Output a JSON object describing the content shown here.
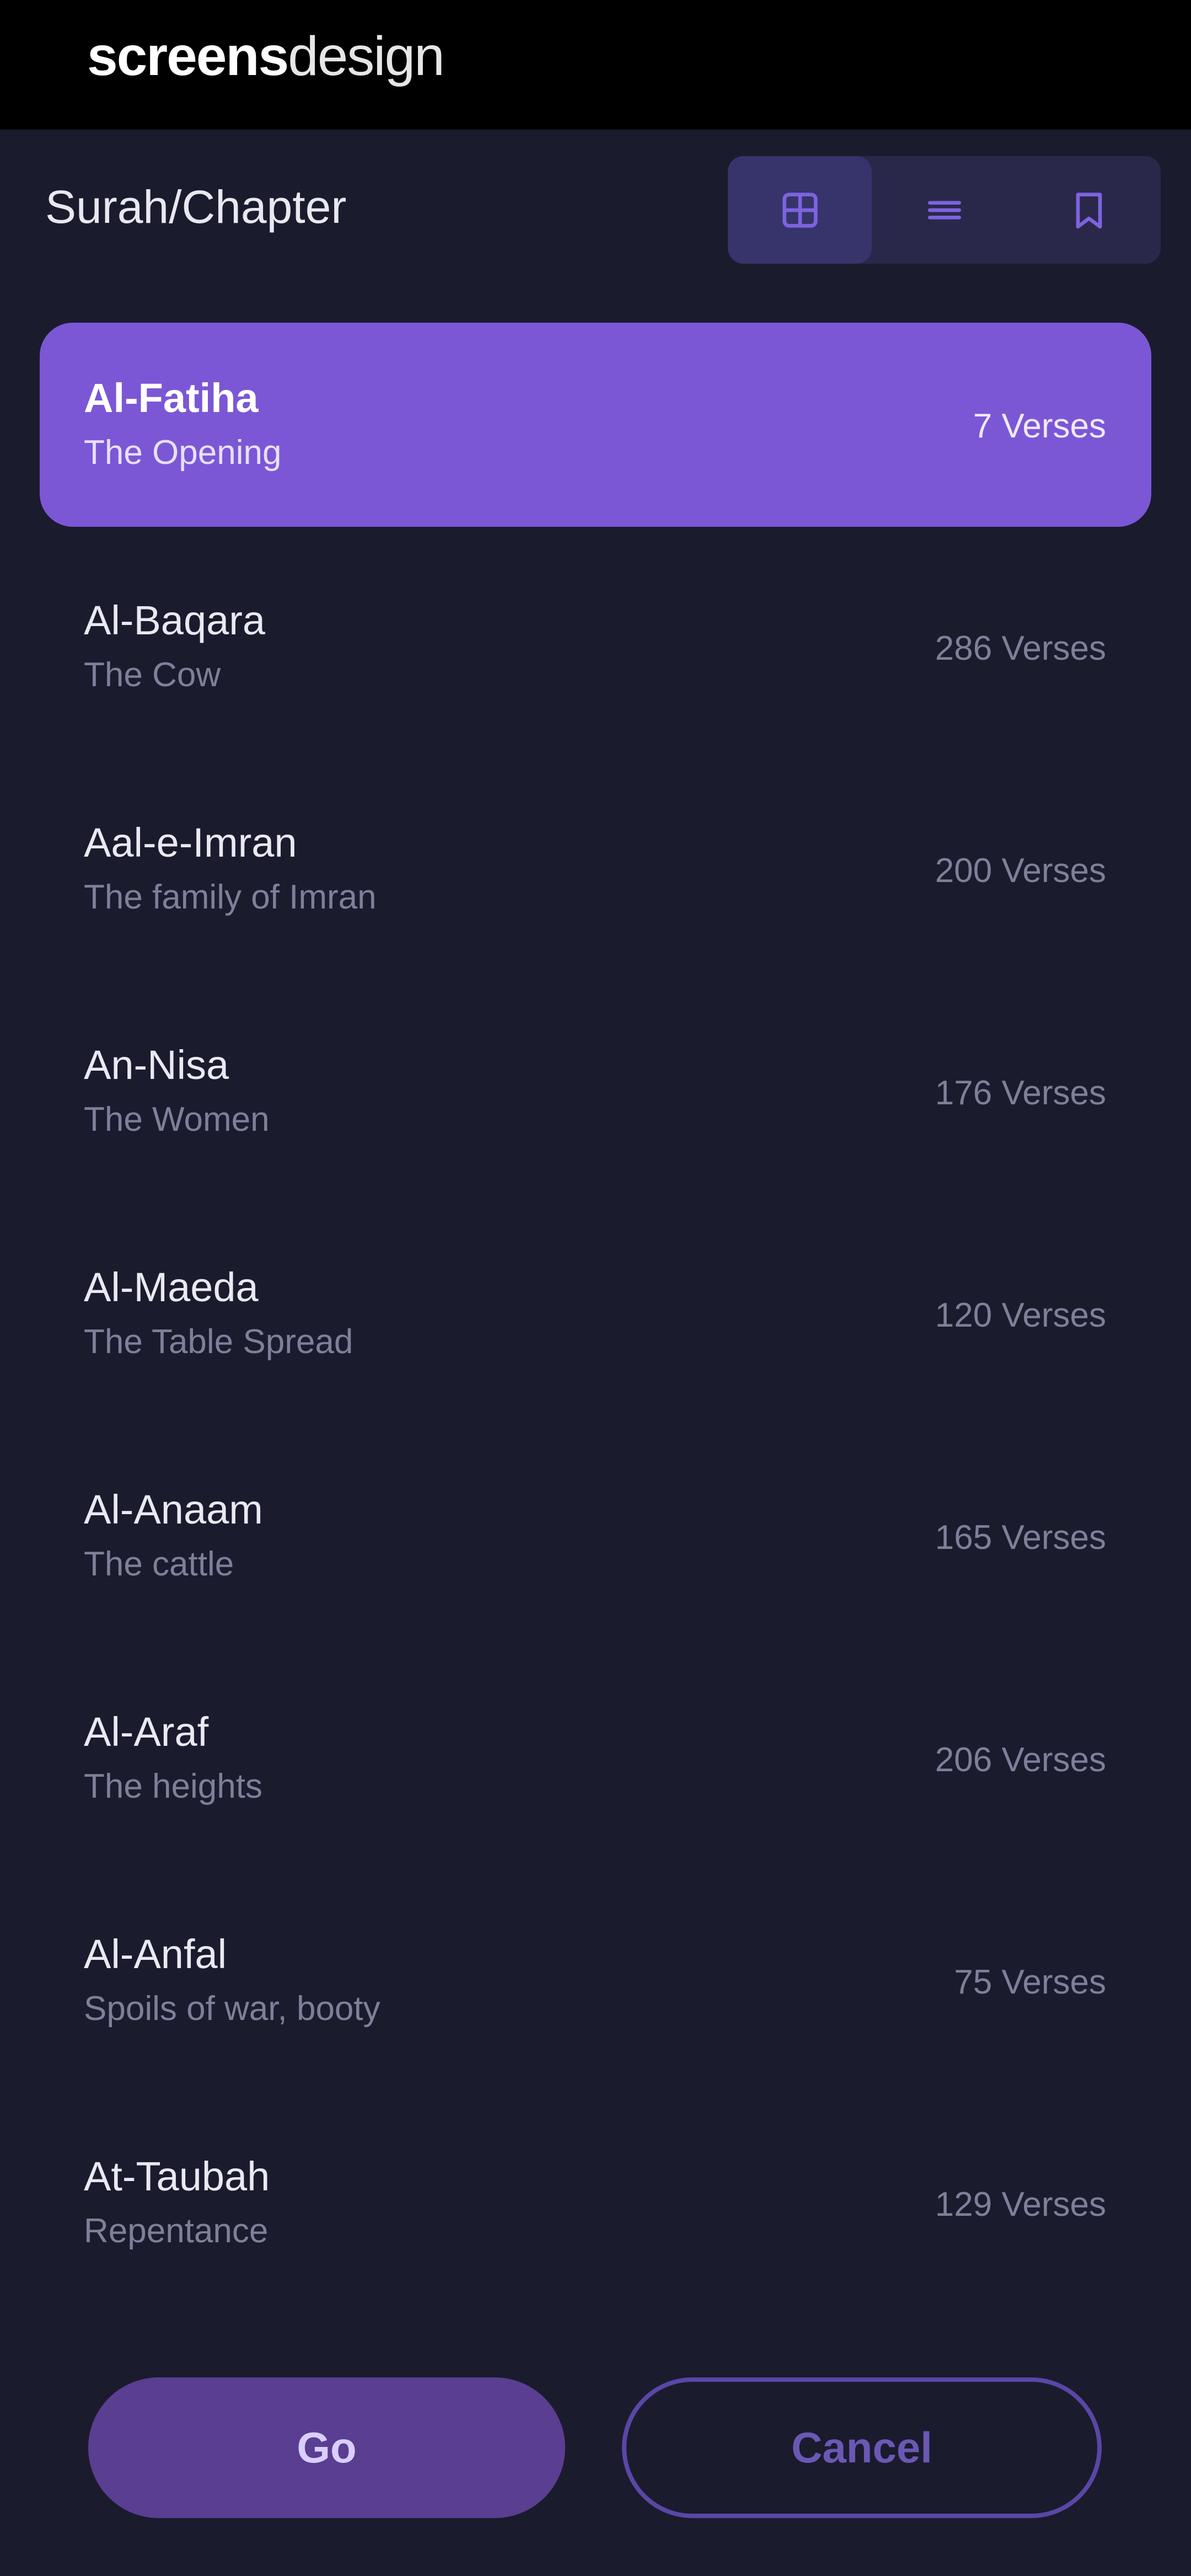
{
  "brand": {
    "strong": "screens",
    "light": "design"
  },
  "header": {
    "title": "Surah/Chapter"
  },
  "view_switcher": {
    "items": [
      {
        "icon": "grid-icon",
        "active": true
      },
      {
        "icon": "list-icon",
        "active": false
      },
      {
        "icon": "bookmark-icon",
        "active": false
      }
    ]
  },
  "colors": {
    "background": "#1b1b2e",
    "accent": "#7b57d6",
    "go_button": "#593e91",
    "cancel_border": "#5a46a6"
  },
  "surahs": [
    {
      "name": "Al-Fatiha",
      "meaning": "The Opening",
      "verses": "7 Verses",
      "selected": true
    },
    {
      "name": "Al-Baqara",
      "meaning": "The Cow",
      "verses": "286 Verses",
      "selected": false
    },
    {
      "name": "Aal-e-Imran",
      "meaning": "The family of Imran",
      "verses": "200 Verses",
      "selected": false
    },
    {
      "name": "An-Nisa",
      "meaning": "The Women",
      "verses": "176 Verses",
      "selected": false
    },
    {
      "name": "Al-Maeda",
      "meaning": "The Table Spread",
      "verses": "120 Verses",
      "selected": false
    },
    {
      "name": "Al-Anaam",
      "meaning": "The cattle",
      "verses": "165 Verses",
      "selected": false
    },
    {
      "name": "Al-Araf",
      "meaning": "The heights",
      "verses": "206 Verses",
      "selected": false
    },
    {
      "name": "Al-Anfal",
      "meaning": "Spoils of war, booty",
      "verses": "75 Verses",
      "selected": false
    },
    {
      "name": "At-Taubah",
      "meaning": "Repentance",
      "verses": "129 Verses",
      "selected": false
    }
  ],
  "actions": {
    "go_label": "Go",
    "cancel_label": "Cancel"
  }
}
